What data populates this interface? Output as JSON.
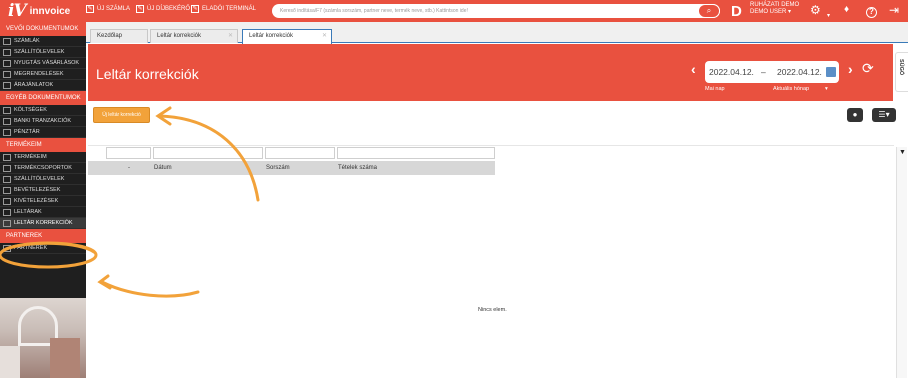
{
  "app": {
    "logo_mark": "iV",
    "logo_text": "innvoice"
  },
  "quick_actions": [
    {
      "label": "ÚJ SZÁMLA",
      "icon": "edit-icon"
    },
    {
      "label": "ÚJ DÍJBEKÉRŐ",
      "icon": "edit-icon"
    },
    {
      "label": "ELADÓI TERMINÁL",
      "icon": "edit-icon"
    }
  ],
  "search": {
    "placeholder": "Kereső indítása/F7 (számla sorszám, partner neve, termék neve, stb.) Kattintson ide!",
    "button_icon": "search-icon"
  },
  "user": {
    "initial": "D",
    "line1": "RUHÁZATI DEMO",
    "line2": "DEMO USER ▾"
  },
  "top_icons": {
    "settings": "⚙",
    "bell": "🔔",
    "help": "?",
    "logout": "⇥"
  },
  "sidebar": {
    "sections": [
      {
        "title": "VEVŐI DOKUMENTUMOK",
        "items": [
          "SZÁMLÁK",
          "SZÁLLÍTÓLEVELEK",
          "NYUGTÁS VÁSÁRLÁSOK",
          "MEGRENDELÉSEK",
          "ÁRAJÁNLATOK"
        ]
      },
      {
        "title": "EGYÉB DOKUMENTUMOK",
        "items": [
          "KÖLTSÉGEK",
          "BANKI TRANZAKCIÓK",
          "PÉNZTÁR"
        ]
      },
      {
        "title": "TERMÉKEIM",
        "items": [
          "TERMÉKEIM",
          "TERMÉKCSOPORTOK",
          "SZÁLLÍTÓLEVELEK",
          "BEVÉTELEZÉSEK",
          "KIVÉTELEZÉSEK",
          "LELTÁRAK",
          "LELTÁR KORREKCIÓK"
        ]
      },
      {
        "title": "PARTNEREK",
        "items": [
          "PARTNEREK"
        ]
      }
    ]
  },
  "tabs": [
    {
      "label": "Kezdőlap"
    },
    {
      "label": "Leltár korrekciók"
    },
    {
      "label": "Leltár korrekciók"
    }
  ],
  "header": {
    "title": "Leltár korrekciók",
    "date_from": "2022.04.12.",
    "date_separator": "–",
    "date_to": "2022.04.12.",
    "preset_left": "Mai nap",
    "preset_right": "Aktuális hónap"
  },
  "side_tab": {
    "label": "SÚGÓ"
  },
  "new_button": {
    "label": "Új leltár korrekció"
  },
  "table": {
    "columns": [
      "-",
      "Dátum",
      "Sorszám",
      "Tételek száma"
    ],
    "empty_text": "Nincs elem."
  },
  "colors": {
    "brand": "#e9513f",
    "button": "#f2a23a",
    "sidebar": "#1f1f1f",
    "annotation": "#f2a23a"
  }
}
